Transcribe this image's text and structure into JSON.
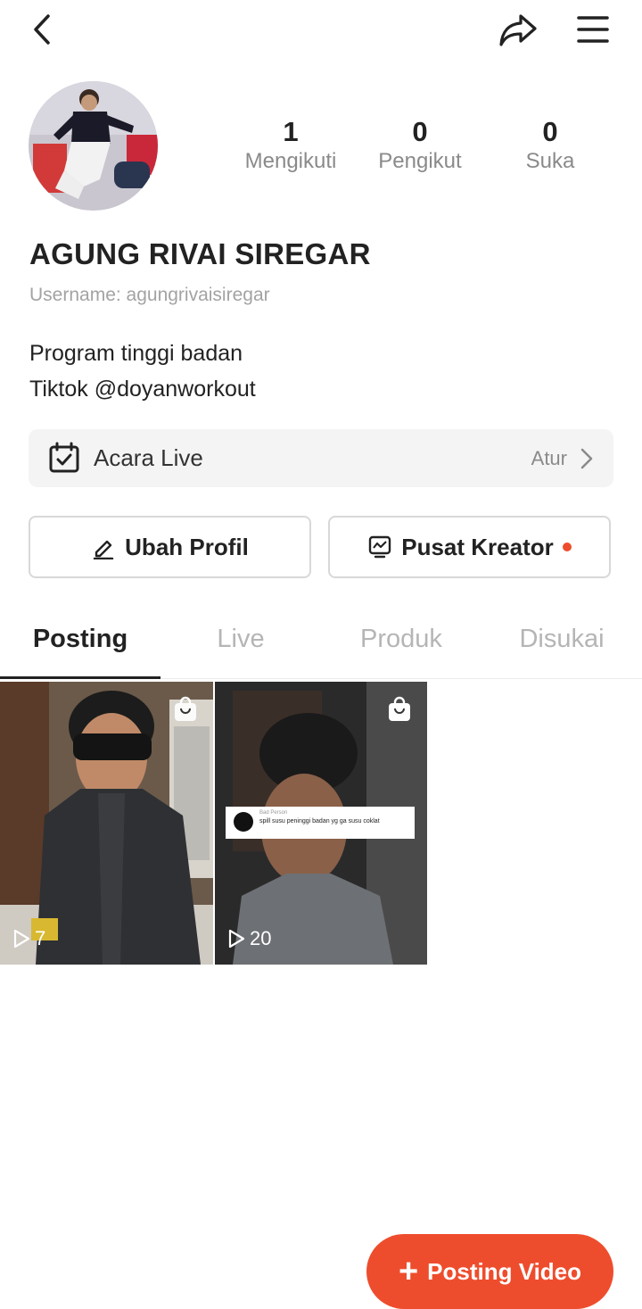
{
  "profile": {
    "name": "AGUNG RIVAI SIREGAR",
    "username": "Username: agungrivaisiregar",
    "bio_line1": "Program tinggi badan",
    "bio_line2": "Tiktok @doyanworkout"
  },
  "stats": [
    {
      "value": "1",
      "label": "Mengikuti"
    },
    {
      "value": "0",
      "label": "Pengikut"
    },
    {
      "value": "0",
      "label": "Suka"
    }
  ],
  "live_event": {
    "label": "Acara Live",
    "action": "Atur"
  },
  "buttons": {
    "edit_profile": "Ubah Profil",
    "creator_center": "Pusat Kreator"
  },
  "tabs": [
    {
      "label": "Posting",
      "active": true
    },
    {
      "label": "Live"
    },
    {
      "label": "Produk"
    },
    {
      "label": "Disukai"
    }
  ],
  "posts": [
    {
      "views": "7"
    },
    {
      "views": "20",
      "caption_user": "Bad Person",
      "caption_text": "spill susu peninggi badan yg ga susu coklat"
    }
  ],
  "fab": {
    "label": "Posting Video"
  },
  "icons": [
    "back-icon",
    "share-icon",
    "menu-icon",
    "calendar-icon",
    "chevron-right-icon",
    "pencil-icon",
    "chart-icon",
    "play-icon",
    "shopping-bag-icon",
    "plus-icon"
  ],
  "colors": {
    "accent": "#ee4d2d",
    "muted": "#8a8a8a"
  }
}
